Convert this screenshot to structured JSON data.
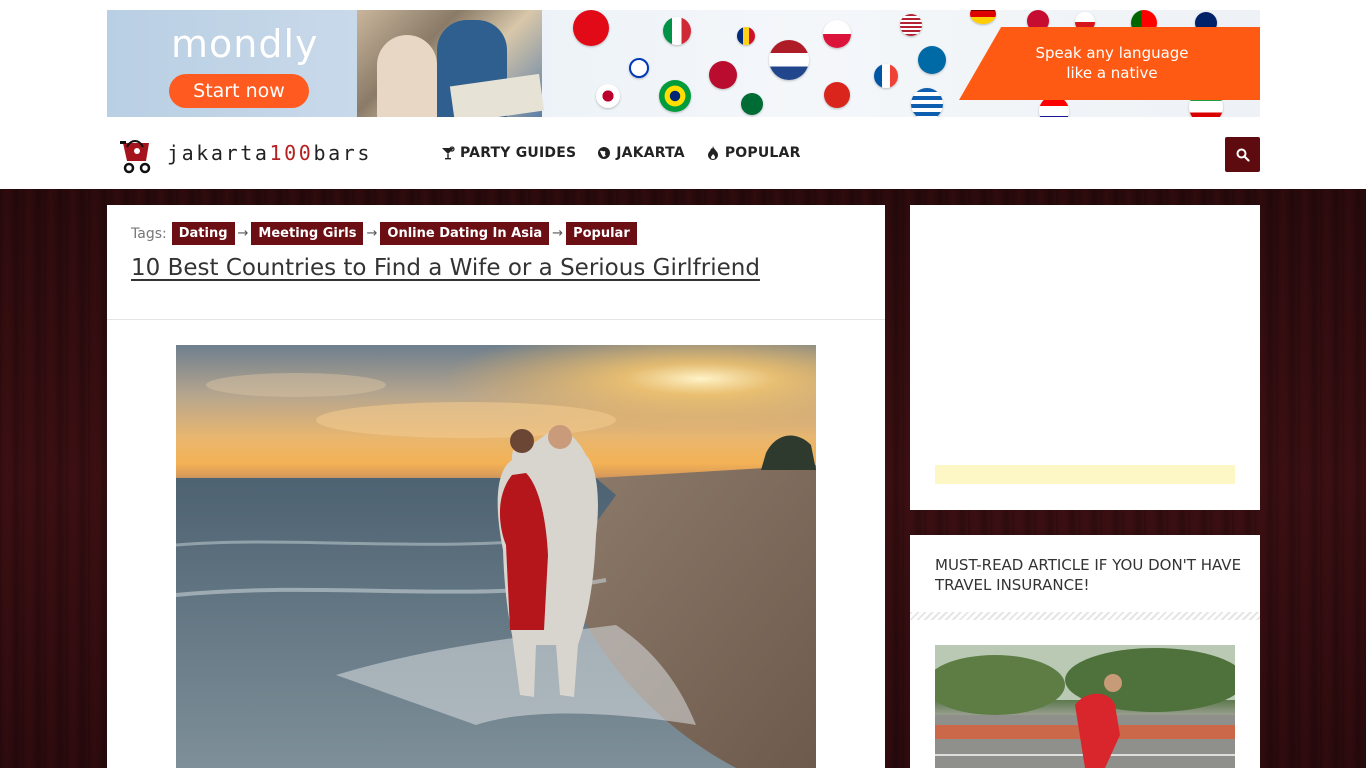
{
  "banner": {
    "brand": "mondly",
    "cta_label": "Start now",
    "tagline_line1": "Speak any language",
    "tagline_line2": "like a native",
    "accent_color": "#ff5a14"
  },
  "site": {
    "logo_text_prefix": "jakarta",
    "logo_text_accent": "100",
    "logo_text_suffix": "bars",
    "brand_color": "#5e0b10"
  },
  "nav": {
    "items": [
      {
        "label": "PARTY GUIDES",
        "icon": "cocktail-icon"
      },
      {
        "label": "JAKARTA",
        "icon": "globe-icon"
      },
      {
        "label": "POPULAR",
        "icon": "fire-icon"
      }
    ],
    "search_icon": "search-icon"
  },
  "article": {
    "tags_label": "Tags:",
    "tags": [
      "Dating",
      "Meeting Girls",
      "Online Dating In Asia",
      "Popular"
    ],
    "tag_separator": "→",
    "title": "10 Best Countries to Find a Wife or a Serious Girlfriend"
  },
  "sidebar": {
    "promo_title": "MUST-READ ARTICLE IF YOU DON'T HAVE TRAVEL INSURANCE!"
  }
}
